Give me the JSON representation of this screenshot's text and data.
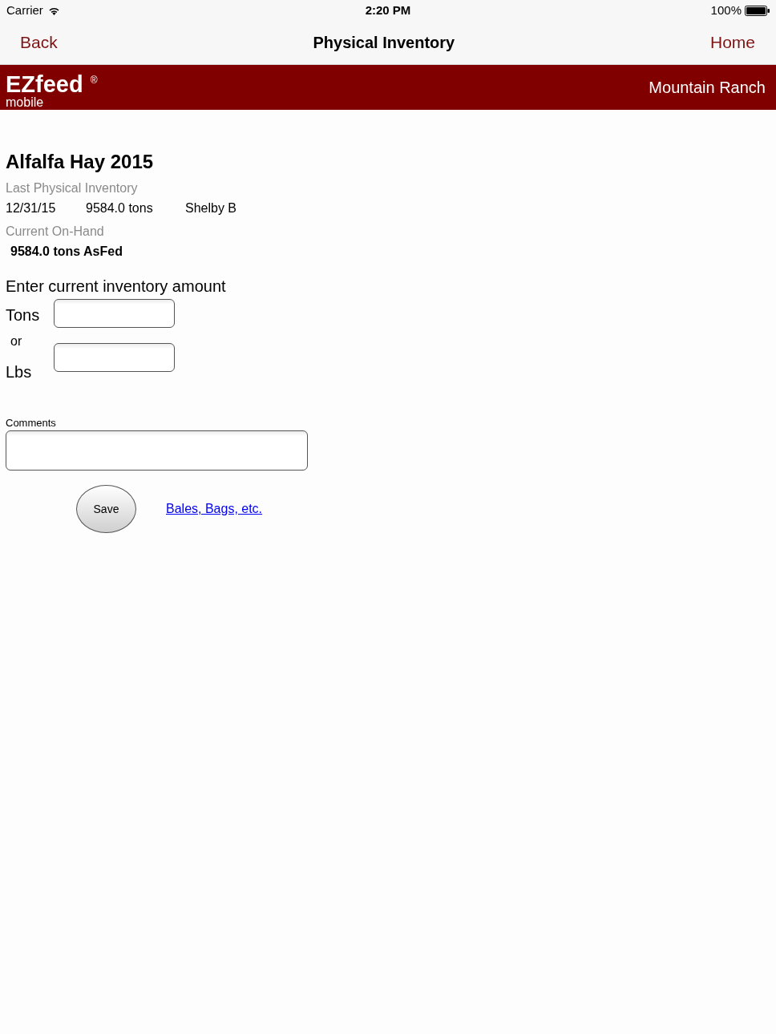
{
  "status_bar": {
    "carrier": "Carrier",
    "time": "2:20 PM",
    "battery": "100%"
  },
  "nav_bar": {
    "back": "Back",
    "title": "Physical Inventory",
    "home": "Home"
  },
  "brand_bar": {
    "logo": "EZfeed",
    "registered": "®",
    "tagline": "mobile",
    "ranch": "Mountain Ranch"
  },
  "item": {
    "title": "Alfalfa Hay 2015",
    "last_inventory_label": "Last Physical Inventory",
    "last_inventory": [
      "12/31/15",
      "9584.0 tons",
      "Shelby B"
    ],
    "on_hand_label": "Current On-Hand",
    "on_hand": "9584.0 tons AsFed"
  },
  "entry": {
    "heading": "Enter current inventory amount",
    "fields": [
      {
        "label": "Tons"
      },
      {
        "label": "Lbs"
      }
    ],
    "separator": "or"
  },
  "comments": {
    "label": "Comments"
  },
  "actions": {
    "save": "Save",
    "link": "Bales, Bags, etc."
  }
}
